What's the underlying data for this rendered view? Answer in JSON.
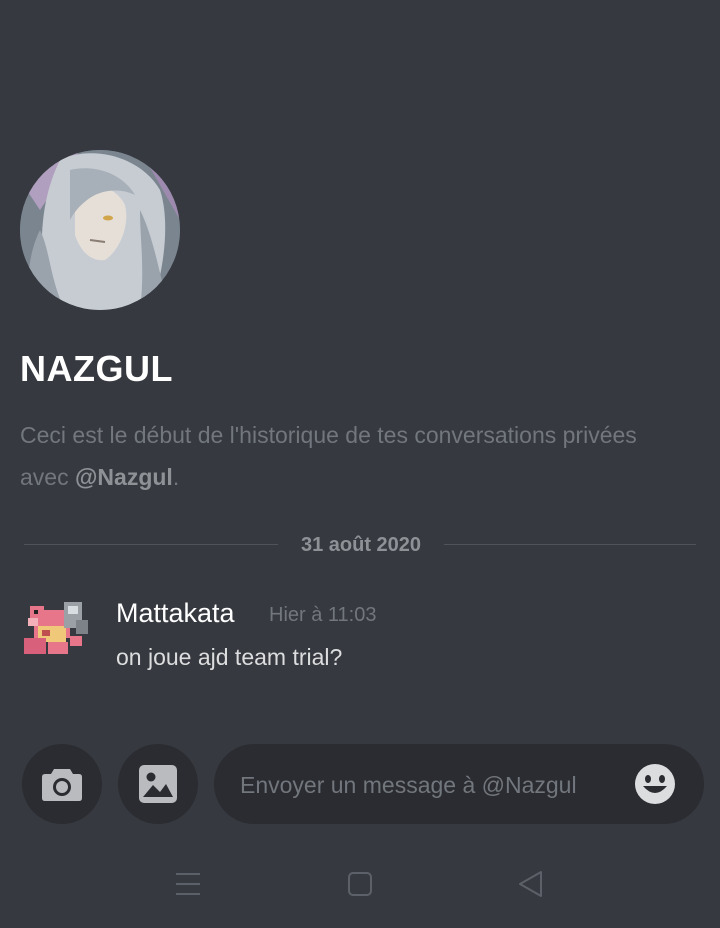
{
  "profile": {
    "name": "NAZGUL",
    "intro_prefix": "Ceci est le début de l'historique de tes conversations privées avec ",
    "intro_mention": "@Nazgul",
    "intro_suffix": "."
  },
  "date_divider": "31 août 2020",
  "messages": [
    {
      "author": "Mattakata",
      "time": "Hier à 11:03",
      "text": "on joue ajd team trial?"
    }
  ],
  "composer": {
    "placeholder": "Envoyer un message à @Nazgul"
  },
  "icons": {
    "camera": "camera-icon",
    "gallery": "image-icon",
    "emoji": "emoji-icon",
    "menu": "menu-icon",
    "home": "home-icon",
    "back": "back-icon"
  },
  "colors": {
    "background": "#36393f",
    "input_bg": "#2a2c31",
    "muted": "#72767d"
  }
}
